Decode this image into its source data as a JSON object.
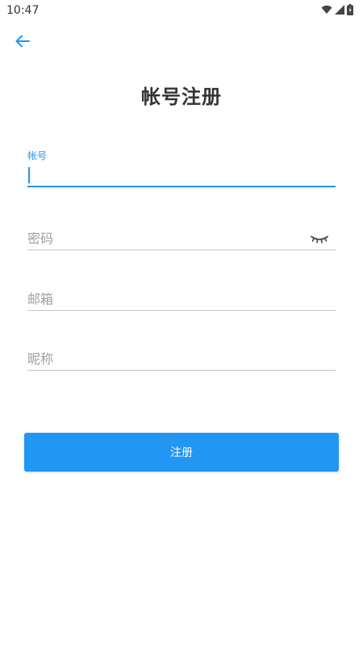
{
  "status_bar": {
    "time": "10:47",
    "icons": [
      "wifi-icon",
      "signal-icon",
      "battery-icon"
    ]
  },
  "header": {
    "back_icon": "arrow-left-icon",
    "title": "帐号注册"
  },
  "form": {
    "account": {
      "label": "帐号",
      "value": ""
    },
    "password": {
      "placeholder": "密码",
      "value": "",
      "toggle_icon": "eye-closed-icon"
    },
    "email": {
      "placeholder": "邮箱",
      "value": ""
    },
    "nickname": {
      "placeholder": "昵称",
      "value": ""
    }
  },
  "actions": {
    "register_label": "注册"
  },
  "colors": {
    "accent": "#2196f3",
    "title": "#333333",
    "placeholder": "#9e9e9e",
    "divider": "#c4c4c4"
  }
}
